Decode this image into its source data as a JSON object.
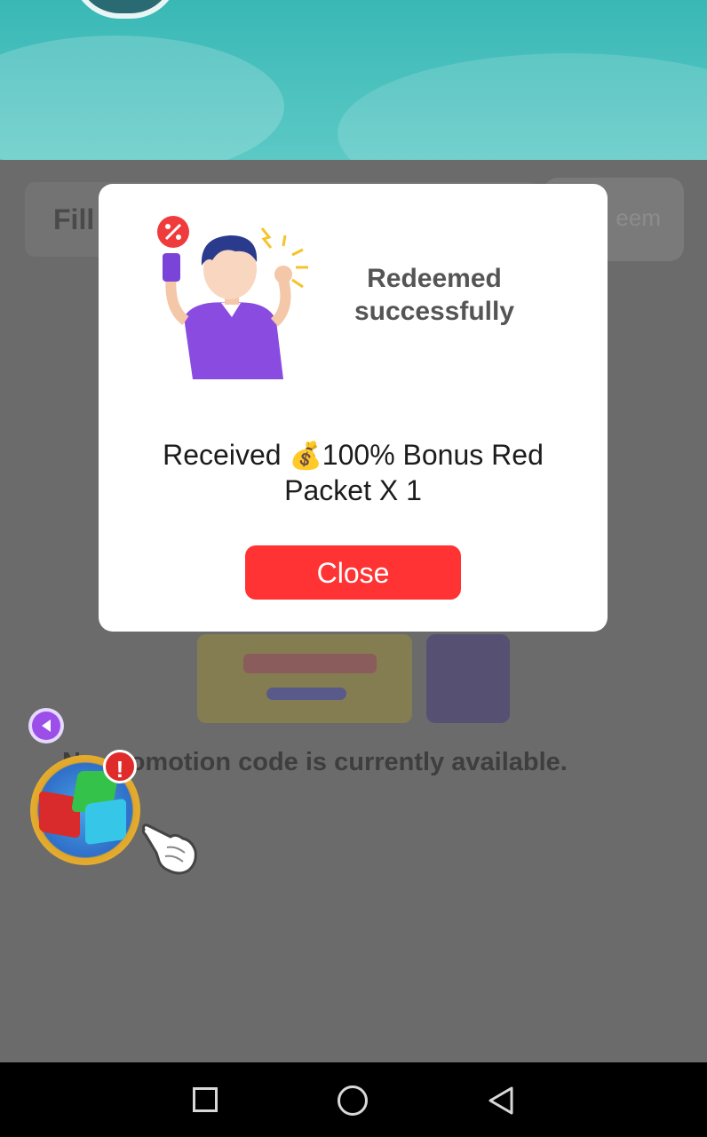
{
  "background": {
    "promo_placeholder": "Fill",
    "redeem_label": "eem",
    "empty_message": "No promotion code is currently available."
  },
  "widgets": {
    "alert_badge": "!",
    "back_icon": "triangle-left-icon",
    "wheel_icon": "gift-wheel-icon",
    "pointer_icon": "pointing-hand-icon"
  },
  "modal": {
    "title": "Redeemed successfully",
    "message_prefix": "Received ",
    "message_icon": "💰",
    "message_rest": "100% Bonus Red Packet X 1",
    "close_label": "Close"
  },
  "navbar": {
    "recent_icon": "square-icon",
    "home_icon": "circle-icon",
    "back_icon": "triangle-back-icon"
  },
  "colors": {
    "accent": "#ff3333",
    "header_teal": "#39b8b6",
    "overlay": "#6b6b6b"
  }
}
